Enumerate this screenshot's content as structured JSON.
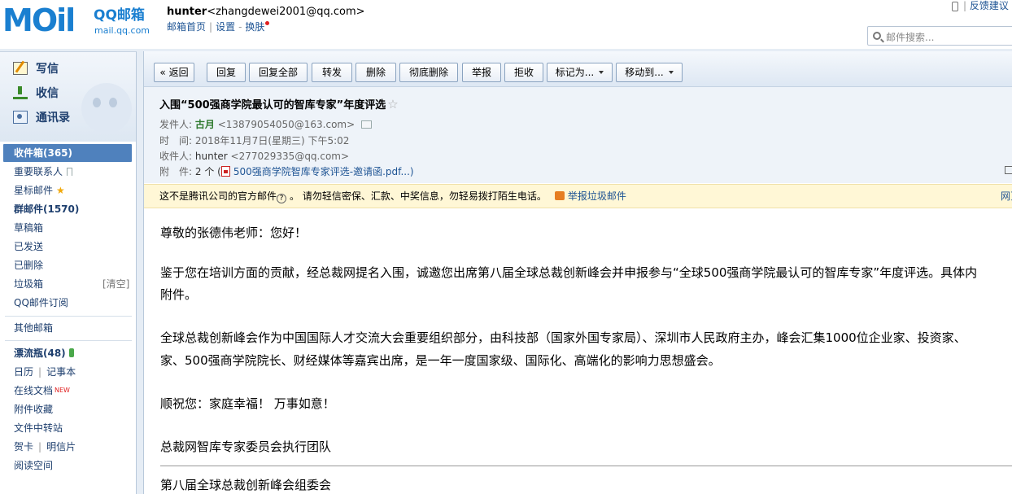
{
  "header": {
    "logo_text": "MOil",
    "logo_brand": "QQ邮箱",
    "logo_domain": "mail.qq.com",
    "user_name": "hunter",
    "user_email": "<zhangdewei2001@qq.com>",
    "links": [
      "邮箱首页",
      "设置",
      "换肤"
    ],
    "feedback": "反馈建议",
    "search_placeholder": "邮件搜索..."
  },
  "nav": {
    "main": [
      "写信",
      "收信",
      "通讯录"
    ],
    "inbox": "收件箱(365)",
    "important": "重要联系人",
    "starred": "星标邮件",
    "groups": "群邮件(1570)",
    "drafts": "草稿箱",
    "sent": "已发送",
    "deleted": "已删除",
    "spam": "垃圾箱",
    "clear": "[清空]",
    "subscribe": "QQ邮件订阅",
    "other": "其他邮箱",
    "bottle": "漂流瓶(48)",
    "calendar": "日历",
    "notebook": "记事本",
    "docs": "在线文档",
    "docs_new": "NEW",
    "attach": "附件收藏",
    "transfer": "文件中转站",
    "card": "贺卡",
    "postcard": "明信片",
    "reading": "阅读空间"
  },
  "toolbar": {
    "back": "« 返回",
    "reply": "回复",
    "reply_all": "回复全部",
    "forward": "转发",
    "delete": "删除",
    "delete_perm": "彻底删除",
    "report": "举报",
    "reject": "拒收",
    "mark": "标记为...",
    "move": "移动到..."
  },
  "mail": {
    "subject": "入围“500强商学院最认可的智库专家”年度评选",
    "from_label": "发件人:",
    "from_name": "古月",
    "from_addr": "<13879054050@163.com>",
    "time_label": "时　间:",
    "time": "2018年11月7日(星期三) 下午5:02",
    "to_label": "收件人:",
    "to_name": "hunter",
    "to_addr": "<277029335@qq.com>",
    "attach_label": "附　件:",
    "attach_count": "2 个 (",
    "attach_name": "500强商学院智库专家评选-邀请函.pdf...)",
    "warn_text": "这不是腾讯公司的官方邮件",
    "warn_q": "?",
    "warn_text2": "。  请勿轻信密保、汇款、中奖信息，勿轻易拨打陌生电话。",
    "warn_report": "举报垃圾邮件",
    "warn_right": "网页",
    "body": [
      "尊敬的张德伟老师：您好！",
      "鉴于您在培训方面的贡献，经总裁网提名入围，诚邀您出席第八届全球总裁创新峰会并申报参与“全球500强商学院最认可的智库专家”年度评选。具体内",
      "附件。",
      "全球总裁创新峰会作为中国国际人才交流大会重要组织部分，由科技部（国家外国专家局）、深圳市人民政府主办，峰会汇集1000位企业家、投资家、",
      "家、500强商学院院长、财经媒体等嘉宾出席，是一年一度国家级、国际化、高端化的影响力思想盛会。",
      "顺祝您：家庭幸福！ 万事如意！",
      "总裁网智库专家委员会执行团队",
      "第八届全球总裁创新峰会组委会"
    ]
  }
}
